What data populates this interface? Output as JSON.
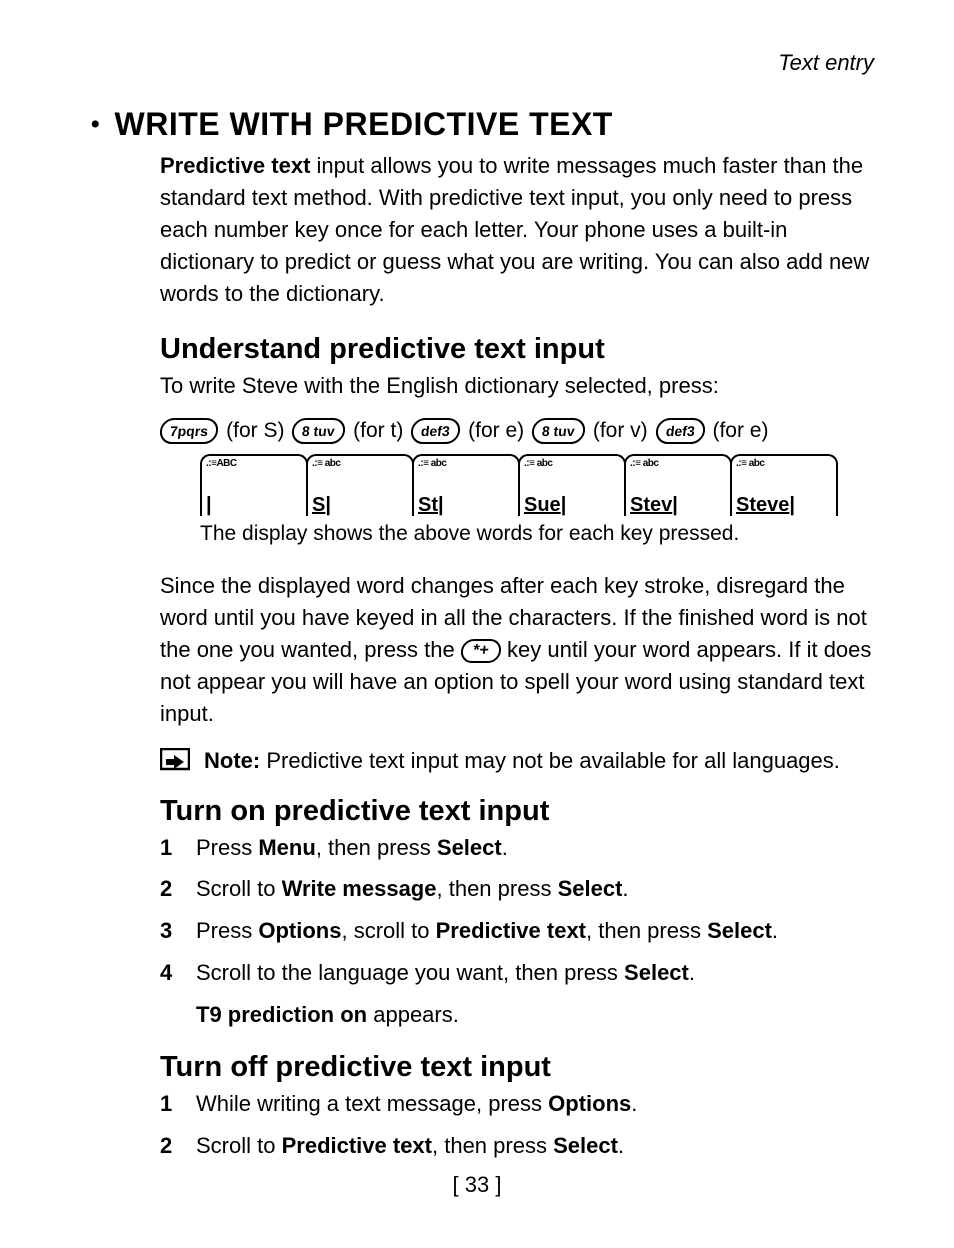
{
  "header": {
    "running": "Text entry"
  },
  "h1": "WRITE WITH PREDICTIVE TEXT",
  "intro": {
    "lead_bold": "Predictive text",
    "lead_rest": " input allows you to write messages much faster than the standard text method. With predictive text input, you only need to press each number key once for each letter. Your phone uses a built-in dictionary to predict or guess what you are writing. You can also add new words to the dictionary."
  },
  "section1": {
    "title": "Understand predictive text input",
    "line1": "To write Steve with the English dictionary selected, press:",
    "keys": [
      {
        "label": "7pqrs",
        "for": "(for S)"
      },
      {
        "label": "8 tuv",
        "for": "(for t)"
      },
      {
        "label": "def3",
        "for": "(for e)"
      },
      {
        "label": "8 tuv",
        "for": "(for v)"
      },
      {
        "label": "def3",
        "for": "(for e)"
      }
    ],
    "screens": [
      {
        "top": ".:≡ABC",
        "word": "|"
      },
      {
        "top": ".:≡ abc",
        "word": "S"
      },
      {
        "top": ".:≡ abc",
        "word": "St"
      },
      {
        "top": ".:≡ abc",
        "word": "Sue"
      },
      {
        "top": ".:≡ abc",
        "word": "Stev"
      },
      {
        "top": ".:≡ abc",
        "word": "Steve"
      }
    ],
    "caption": "The display shows the above words for each key pressed.",
    "para2_before": "Since the displayed word changes after each key stroke, disregard the word until you have keyed in all the characters. If the finished word is not the one you wanted, press the ",
    "star_key": "*+",
    "para2_after": " key until your word appears. If it does not appear you will have an option to spell your word using standard text input.",
    "note_bold": "Note:",
    "note_rest": " Predictive text input may not be available for all languages."
  },
  "section2": {
    "title": "Turn on predictive text input",
    "steps": [
      {
        "pre": "Press ",
        "b1": "Menu",
        "mid": ", then press ",
        "b2": "Select",
        "post": "."
      },
      {
        "pre": "Scroll to ",
        "b1": "Write message",
        "mid": ", then press ",
        "b2": "Select",
        "post": "."
      },
      {
        "pre": "Press ",
        "b1": "Options",
        "mid": ", scroll to ",
        "b2": "Predictive text",
        "mid2": ", then press ",
        "b3": "Select",
        "post": "."
      },
      {
        "pre": "Scroll to the language you want, then press ",
        "b1": "Select",
        "post": ".",
        "extra_bold": "T9 prediction on",
        "extra_rest": " appears."
      }
    ]
  },
  "section3": {
    "title": "Turn off predictive text input",
    "steps": [
      {
        "pre": "While writing a text message, press ",
        "b1": "Options",
        "post": "."
      },
      {
        "pre": "Scroll to ",
        "b1": "Predictive text",
        "mid": ", then press ",
        "b2": "Select",
        "post": "."
      }
    ]
  },
  "page_number": "[ 33 ]"
}
